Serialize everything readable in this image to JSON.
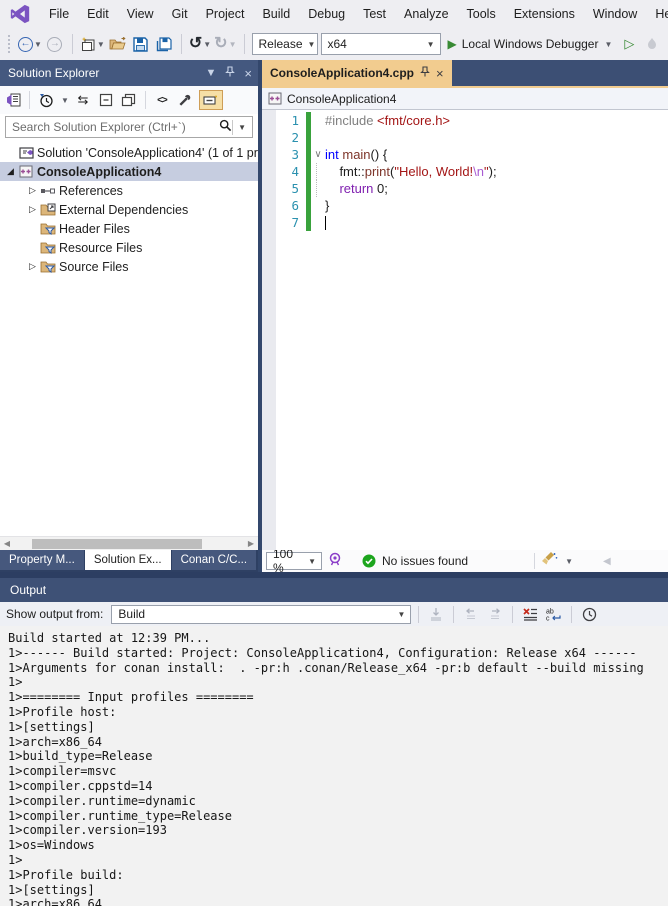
{
  "colors": {
    "accent_purple": "#7B53C1",
    "chrome_bg": "#EEEEF2",
    "frame_dark": "#33476C",
    "panel_title_bg": "#44587F",
    "active_tab_tan": "#F2CC8F",
    "selection_row": "#C6CDE0",
    "change_bar_green": "#39A23C",
    "run_green": "#388A34",
    "check_green": "#1DA51D",
    "line_number_blue": "#2B91AF"
  },
  "menu": {
    "items": [
      "File",
      "Edit",
      "View",
      "Git",
      "Project",
      "Build",
      "Debug",
      "Test",
      "Analyze",
      "Tools",
      "Extensions",
      "Window",
      "Help"
    ]
  },
  "toolbar": {
    "configuration": "Release",
    "platform": "x64",
    "run_label": "Local Windows Debugger"
  },
  "solution_explorer": {
    "title": "Solution Explorer",
    "search_placeholder": "Search Solution Explorer (Ctrl+`)",
    "tree": [
      {
        "indent": 0,
        "arrow": "",
        "icon": "solution",
        "label": "Solution 'ConsoleApplication4' (1 of 1 pro",
        "selected": false,
        "bold": false
      },
      {
        "indent": 0,
        "arrow": "expanded",
        "icon": "project",
        "label": "ConsoleApplication4",
        "selected": true,
        "bold": true
      },
      {
        "indent": 1,
        "arrow": "collapsed",
        "icon": "references",
        "label": "References",
        "selected": false,
        "bold": false
      },
      {
        "indent": 1,
        "arrow": "collapsed",
        "icon": "extdeps",
        "label": "External Dependencies",
        "selected": false,
        "bold": false
      },
      {
        "indent": 1,
        "arrow": "",
        "icon": "folderFilter",
        "label": "Header Files",
        "selected": false,
        "bold": false
      },
      {
        "indent": 1,
        "arrow": "",
        "icon": "folderFilter",
        "label": "Resource Files",
        "selected": false,
        "bold": false
      },
      {
        "indent": 1,
        "arrow": "collapsed",
        "icon": "folderFilter",
        "label": "Source Files",
        "selected": false,
        "bold": false
      }
    ],
    "bottom_tabs": [
      {
        "label": "Property M...",
        "active": false
      },
      {
        "label": "Solution Ex...",
        "active": true
      },
      {
        "label": "Conan C/C...",
        "active": false
      }
    ]
  },
  "editor": {
    "tab_label": "ConsoleApplication4.cpp",
    "breadcrumb": "ConsoleApplication4",
    "zoom_level": "100 %",
    "status_message": "No issues found",
    "code_lines": [
      {
        "n": "1",
        "fold": "",
        "tokens": [
          {
            "t": "#include ",
            "c": "pp"
          },
          {
            "t": "<fmt/core.h>",
            "c": "str"
          }
        ]
      },
      {
        "n": "2",
        "fold": "",
        "tokens": []
      },
      {
        "n": "3",
        "fold": "open",
        "tokens": [
          {
            "t": "int",
            "c": "kw"
          },
          {
            "t": " ",
            "c": "pl"
          },
          {
            "t": "main",
            "c": "fn"
          },
          {
            "t": "() {",
            "c": "pl"
          }
        ]
      },
      {
        "n": "4",
        "fold": "guide",
        "tokens": [
          {
            "t": "    fmt::",
            "c": "pl"
          },
          {
            "t": "print",
            "c": "fn"
          },
          {
            "t": "(",
            "c": "pl"
          },
          {
            "t": "\"Hello, World!",
            "c": "str"
          },
          {
            "t": "\\n",
            "c": "esc"
          },
          {
            "t": "\"",
            "c": "str"
          },
          {
            "t": ");",
            "c": "pl"
          }
        ]
      },
      {
        "n": "5",
        "fold": "guide",
        "tokens": [
          {
            "t": "    ",
            "c": "pl"
          },
          {
            "t": "return",
            "c": "ctl"
          },
          {
            "t": " ",
            "c": "pl"
          },
          {
            "t": "0",
            "c": "num"
          },
          {
            "t": ";",
            "c": "pl"
          }
        ]
      },
      {
        "n": "6",
        "fold": "",
        "tokens": [
          {
            "t": "}",
            "c": "pl"
          }
        ]
      },
      {
        "n": "7",
        "fold": "",
        "caret": true,
        "tokens": []
      }
    ]
  },
  "output": {
    "title": "Output",
    "source_label": "Show output from:",
    "source_value": "Build",
    "lines": [
      "Build started at 12:39 PM...",
      "1>------ Build started: Project: ConsoleApplication4, Configuration: Release x64 ------",
      "1>Arguments for conan install:  . -pr:h .conan/Release_x64 -pr:b default --build missing",
      "1>",
      "1>======== Input profiles ========",
      "1>Profile host:",
      "1>[settings]",
      "1>arch=x86_64",
      "1>build_type=Release",
      "1>compiler=msvc",
      "1>compiler.cppstd=14",
      "1>compiler.runtime=dynamic",
      "1>compiler.runtime_type=Release",
      "1>compiler.version=193",
      "1>os=Windows",
      "1>",
      "1>Profile build:",
      "1>[settings]",
      "1>arch=x86_64"
    ]
  }
}
